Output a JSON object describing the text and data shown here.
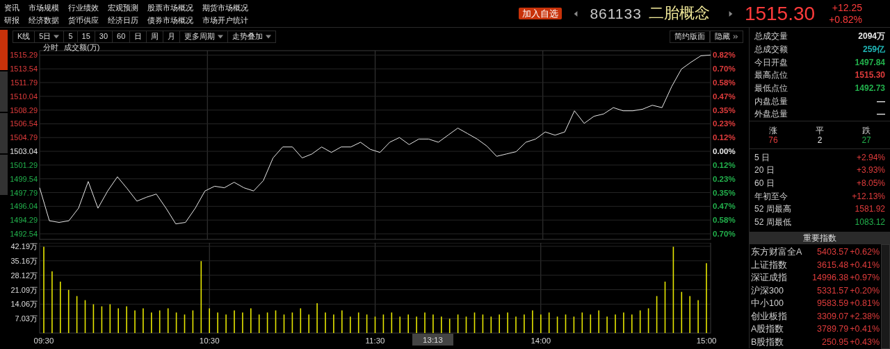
{
  "nav_links": [
    [
      "资讯",
      "市场规模",
      "行业绩效",
      "宏观预测",
      "股票市场概况",
      "期货市场概况"
    ],
    [
      "研报",
      "经济数据",
      "货币供应",
      "经济日历",
      "债券市场概况",
      "市场开户统计"
    ]
  ],
  "quote": {
    "add_button": "加入自选",
    "code": "861133",
    "name": "二胎概念",
    "price": "1515.30",
    "change": "+12.25",
    "percent": "+0.82%"
  },
  "side_tabs": [
    {
      "selected": true
    },
    {
      "selected": false
    },
    {
      "selected": false
    },
    {
      "selected": false
    }
  ],
  "toolbar": [
    {
      "label": "K线",
      "kind": "plain"
    },
    {
      "label": "5日",
      "kind": "dropdown"
    },
    {
      "label": "5",
      "kind": "plain"
    },
    {
      "label": "15",
      "kind": "plain"
    },
    {
      "label": "30",
      "kind": "plain"
    },
    {
      "label": "60",
      "kind": "plain"
    },
    {
      "label": "日",
      "kind": "plain"
    },
    {
      "label": "周",
      "kind": "plain"
    },
    {
      "label": "月",
      "kind": "plain"
    },
    {
      "label": "更多周期",
      "kind": "dropdown"
    },
    {
      "label": "走势叠加",
      "kind": "dropdown"
    }
  ],
  "layout_buttons": [
    {
      "label": "简约版面",
      "kind": "plain"
    },
    {
      "label": "隐藏",
      "kind": "expand"
    }
  ],
  "price_panel": {
    "percent_labels": [
      {
        "label": "0.82%",
        "color": "#e03c3c"
      },
      {
        "label": "0.70%",
        "color": "#e03c3c"
      },
      {
        "label": "0.58%",
        "color": "#e03c3c"
      },
      {
        "label": "0.47%",
        "color": "#e03c3c"
      },
      {
        "label": "0.35%",
        "color": "#e03c3c"
      },
      {
        "label": "0.23%",
        "color": "#e03c3c"
      },
      {
        "label": "0.12%",
        "color": "#e03c3c"
      },
      {
        "label": "0.00%",
        "color": "#e8e8e8"
      },
      {
        "label": "0.12%",
        "color": "#22b14c"
      },
      {
        "label": "0.23%",
        "color": "#22b14c"
      },
      {
        "label": "0.35%",
        "color": "#22b14c"
      },
      {
        "label": "0.47%",
        "color": "#22b14c"
      },
      {
        "label": "0.58%",
        "color": "#22b14c"
      },
      {
        "label": "0.70%",
        "color": "#22b14c"
      }
    ],
    "chart_data": {
      "type": "line",
      "grid": true,
      "categories": [
        null,
        null,
        null,
        null,
        null,
        null,
        null,
        null,
        null,
        null,
        null,
        null,
        null,
        null,
        null,
        null,
        null,
        null,
        null,
        null,
        null,
        null,
        null,
        null,
        null,
        null,
        null,
        null,
        null,
        null,
        null,
        null,
        null,
        null,
        null,
        null,
        null,
        null,
        null,
        null,
        null,
        null,
        null,
        null,
        null,
        null,
        null,
        null,
        null,
        null,
        null,
        null,
        null,
        null,
        null,
        null,
        null,
        null,
        null,
        null,
        null,
        null,
        null,
        null,
        null,
        null,
        null,
        null,
        null,
        null
      ],
      "series": [
        {
          "name": "分时",
          "color": "#e8e8e8",
          "values": [
            1498.4,
            1494.2,
            1494.0,
            1494.2,
            1495.8,
            1499.2,
            1495.8,
            1498.0,
            1499.8,
            1498.3,
            1496.7,
            1497.2,
            1497.6,
            1495.8,
            1493.8,
            1494.0,
            1495.8,
            1498.0,
            1498.6,
            1498.4,
            1499.1,
            1498.4,
            1498.0,
            1499.3,
            1502.2,
            1503.6,
            1503.6,
            1502.2,
            1502.7,
            1503.6,
            1502.9,
            1503.6,
            1503.6,
            1504.2,
            1503.3,
            1502.9,
            1504.2,
            1504.8,
            1503.9,
            1504.6,
            1504.6,
            1504.2,
            1505.1,
            1506.0,
            1505.3,
            1504.6,
            1503.7,
            1502.4,
            1502.7,
            1503.0,
            1504.2,
            1504.6,
            1505.5,
            1505.1,
            1505.5,
            1508.2,
            1506.6,
            1507.5,
            1507.8,
            1508.6,
            1508.2,
            1508.2,
            1508.4,
            1508.9,
            1508.6,
            1511.3,
            1513.5,
            1514.4,
            1515.2,
            1515.3
          ]
        }
      ],
      "ylim": [
        1492.54,
        1515.5
      ],
      "yticks": [
        1492.54,
        1494.29,
        1496.04,
        1497.79,
        1499.54,
        1501.29,
        1503.04,
        1504.79,
        1506.54,
        1508.29,
        1510.04,
        1511.79,
        1513.54,
        1515.29
      ]
    }
  },
  "volume_panel": {
    "cursor_time": "13:13",
    "chart_data": {
      "type": "bar",
      "grid": true,
      "categories": [
        "09:30",
        null,
        null,
        null,
        null,
        null,
        null,
        null,
        null,
        null,
        null,
        null,
        null,
        null,
        null,
        null,
        null,
        null,
        null,
        null,
        "10:30",
        null,
        null,
        null,
        null,
        null,
        null,
        null,
        null,
        null,
        null,
        null,
        null,
        null,
        null,
        null,
        null,
        null,
        null,
        null,
        "11:30",
        null,
        null,
        null,
        null,
        null,
        null,
        null,
        null,
        null,
        null,
        null,
        null,
        null,
        null,
        null,
        null,
        null,
        null,
        null,
        "14:00",
        null,
        null,
        null,
        null,
        null,
        null,
        null,
        null,
        null,
        null,
        null,
        null,
        null,
        null,
        null,
        null,
        null,
        null,
        null,
        "15:00"
      ],
      "series": [
        {
          "name": "成交额(万)",
          "color": "#e6e600",
          "values": [
            42,
            30,
            25,
            21,
            18,
            16,
            14,
            13,
            14,
            12,
            13,
            11,
            12,
            10,
            11,
            12,
            10,
            9,
            11,
            35,
            12,
            10,
            9,
            11,
            10,
            12,
            9,
            10,
            11,
            9,
            10,
            12,
            9,
            14.5,
            10,
            9,
            11,
            8,
            10,
            9,
            8,
            9,
            10,
            8,
            9,
            8,
            10,
            9,
            8,
            7,
            9,
            8,
            10,
            9,
            8,
            9,
            10,
            8,
            9,
            11,
            9,
            10,
            8,
            9,
            8,
            10,
            9,
            11,
            8,
            9,
            10,
            9,
            11,
            12,
            18,
            25,
            42,
            20,
            18,
            16,
            34
          ]
        }
      ],
      "ylim": [
        0,
        42.19
      ],
      "yticks": [
        {
          "value": 7.03,
          "label": "7.03万"
        },
        {
          "value": 14.06,
          "label": "14.06万"
        },
        {
          "value": 21.09,
          "label": "21.09万"
        },
        {
          "value": 28.12,
          "label": "28.12万"
        },
        {
          "value": 35.16,
          "label": "35.16万"
        },
        {
          "value": 42.19,
          "label": "42.19万"
        }
      ]
    }
  },
  "stats": [
    {
      "label": "总成交量",
      "value": "2094万",
      "color": "#e8e8e8"
    },
    {
      "label": "总成交额",
      "value": "259亿",
      "color": "#1fb5b5"
    },
    {
      "label": "今日开盘",
      "value": "1497.84",
      "color": "#22b14c"
    },
    {
      "label": "最高点位",
      "value": "1515.30",
      "color": "#e03c3c"
    },
    {
      "label": "最低点位",
      "value": "1492.73",
      "color": "#22b14c"
    },
    {
      "label": "内盘总量",
      "value": "—",
      "color": "#e8e8e8"
    },
    {
      "label": "外盘总量",
      "value": "—",
      "color": "#e8e8e8"
    }
  ],
  "breadth": [
    {
      "label": "涨",
      "value": "76",
      "color": "#e03c3c"
    },
    {
      "label": "平",
      "value": "2",
      "color": "#e8e8e8"
    },
    {
      "label": "跌",
      "value": "27",
      "color": "#22b14c"
    }
  ],
  "periods": [
    {
      "label": "5 日",
      "value": "+2.94%",
      "color": "#e03c3c"
    },
    {
      "label": "20 日",
      "value": "+3.93%",
      "color": "#e03c3c"
    },
    {
      "label": "60 日",
      "value": "+8.05%",
      "color": "#e03c3c"
    },
    {
      "label": "年初至今",
      "value": "+12.13%",
      "color": "#e03c3c"
    },
    {
      "label": "52 周最高",
      "value": "1581.92",
      "color": "#e03c3c"
    },
    {
      "label": "52 周最低",
      "value": "1083.12",
      "color": "#22b14c"
    }
  ],
  "indices": {
    "title": "重要指数",
    "items": [
      {
        "name": "东方财富全A",
        "value": "5403.57",
        "percent": "+0.62%",
        "color": "#e03c3c"
      },
      {
        "name": "上证指数",
        "value": "3615.48",
        "percent": "+0.41%",
        "color": "#e03c3c"
      },
      {
        "name": "深证成指",
        "value": "14996.38",
        "percent": "+0.97%",
        "color": "#e03c3c"
      },
      {
        "name": "沪深300",
        "value": "5331.57",
        "percent": "+0.20%",
        "color": "#e03c3c"
      },
      {
        "name": "中小100",
        "value": "9583.59",
        "percent": "+0.81%",
        "color": "#e03c3c"
      },
      {
        "name": "创业板指",
        "value": "3309.07",
        "percent": "+2.38%",
        "color": "#e03c3c"
      },
      {
        "name": "A股指数",
        "value": "3789.79",
        "percent": "+0.41%",
        "color": "#e03c3c"
      },
      {
        "name": "B股指数",
        "value": "250.95",
        "percent": "+0.43%",
        "color": "#e03c3c"
      }
    ]
  }
}
